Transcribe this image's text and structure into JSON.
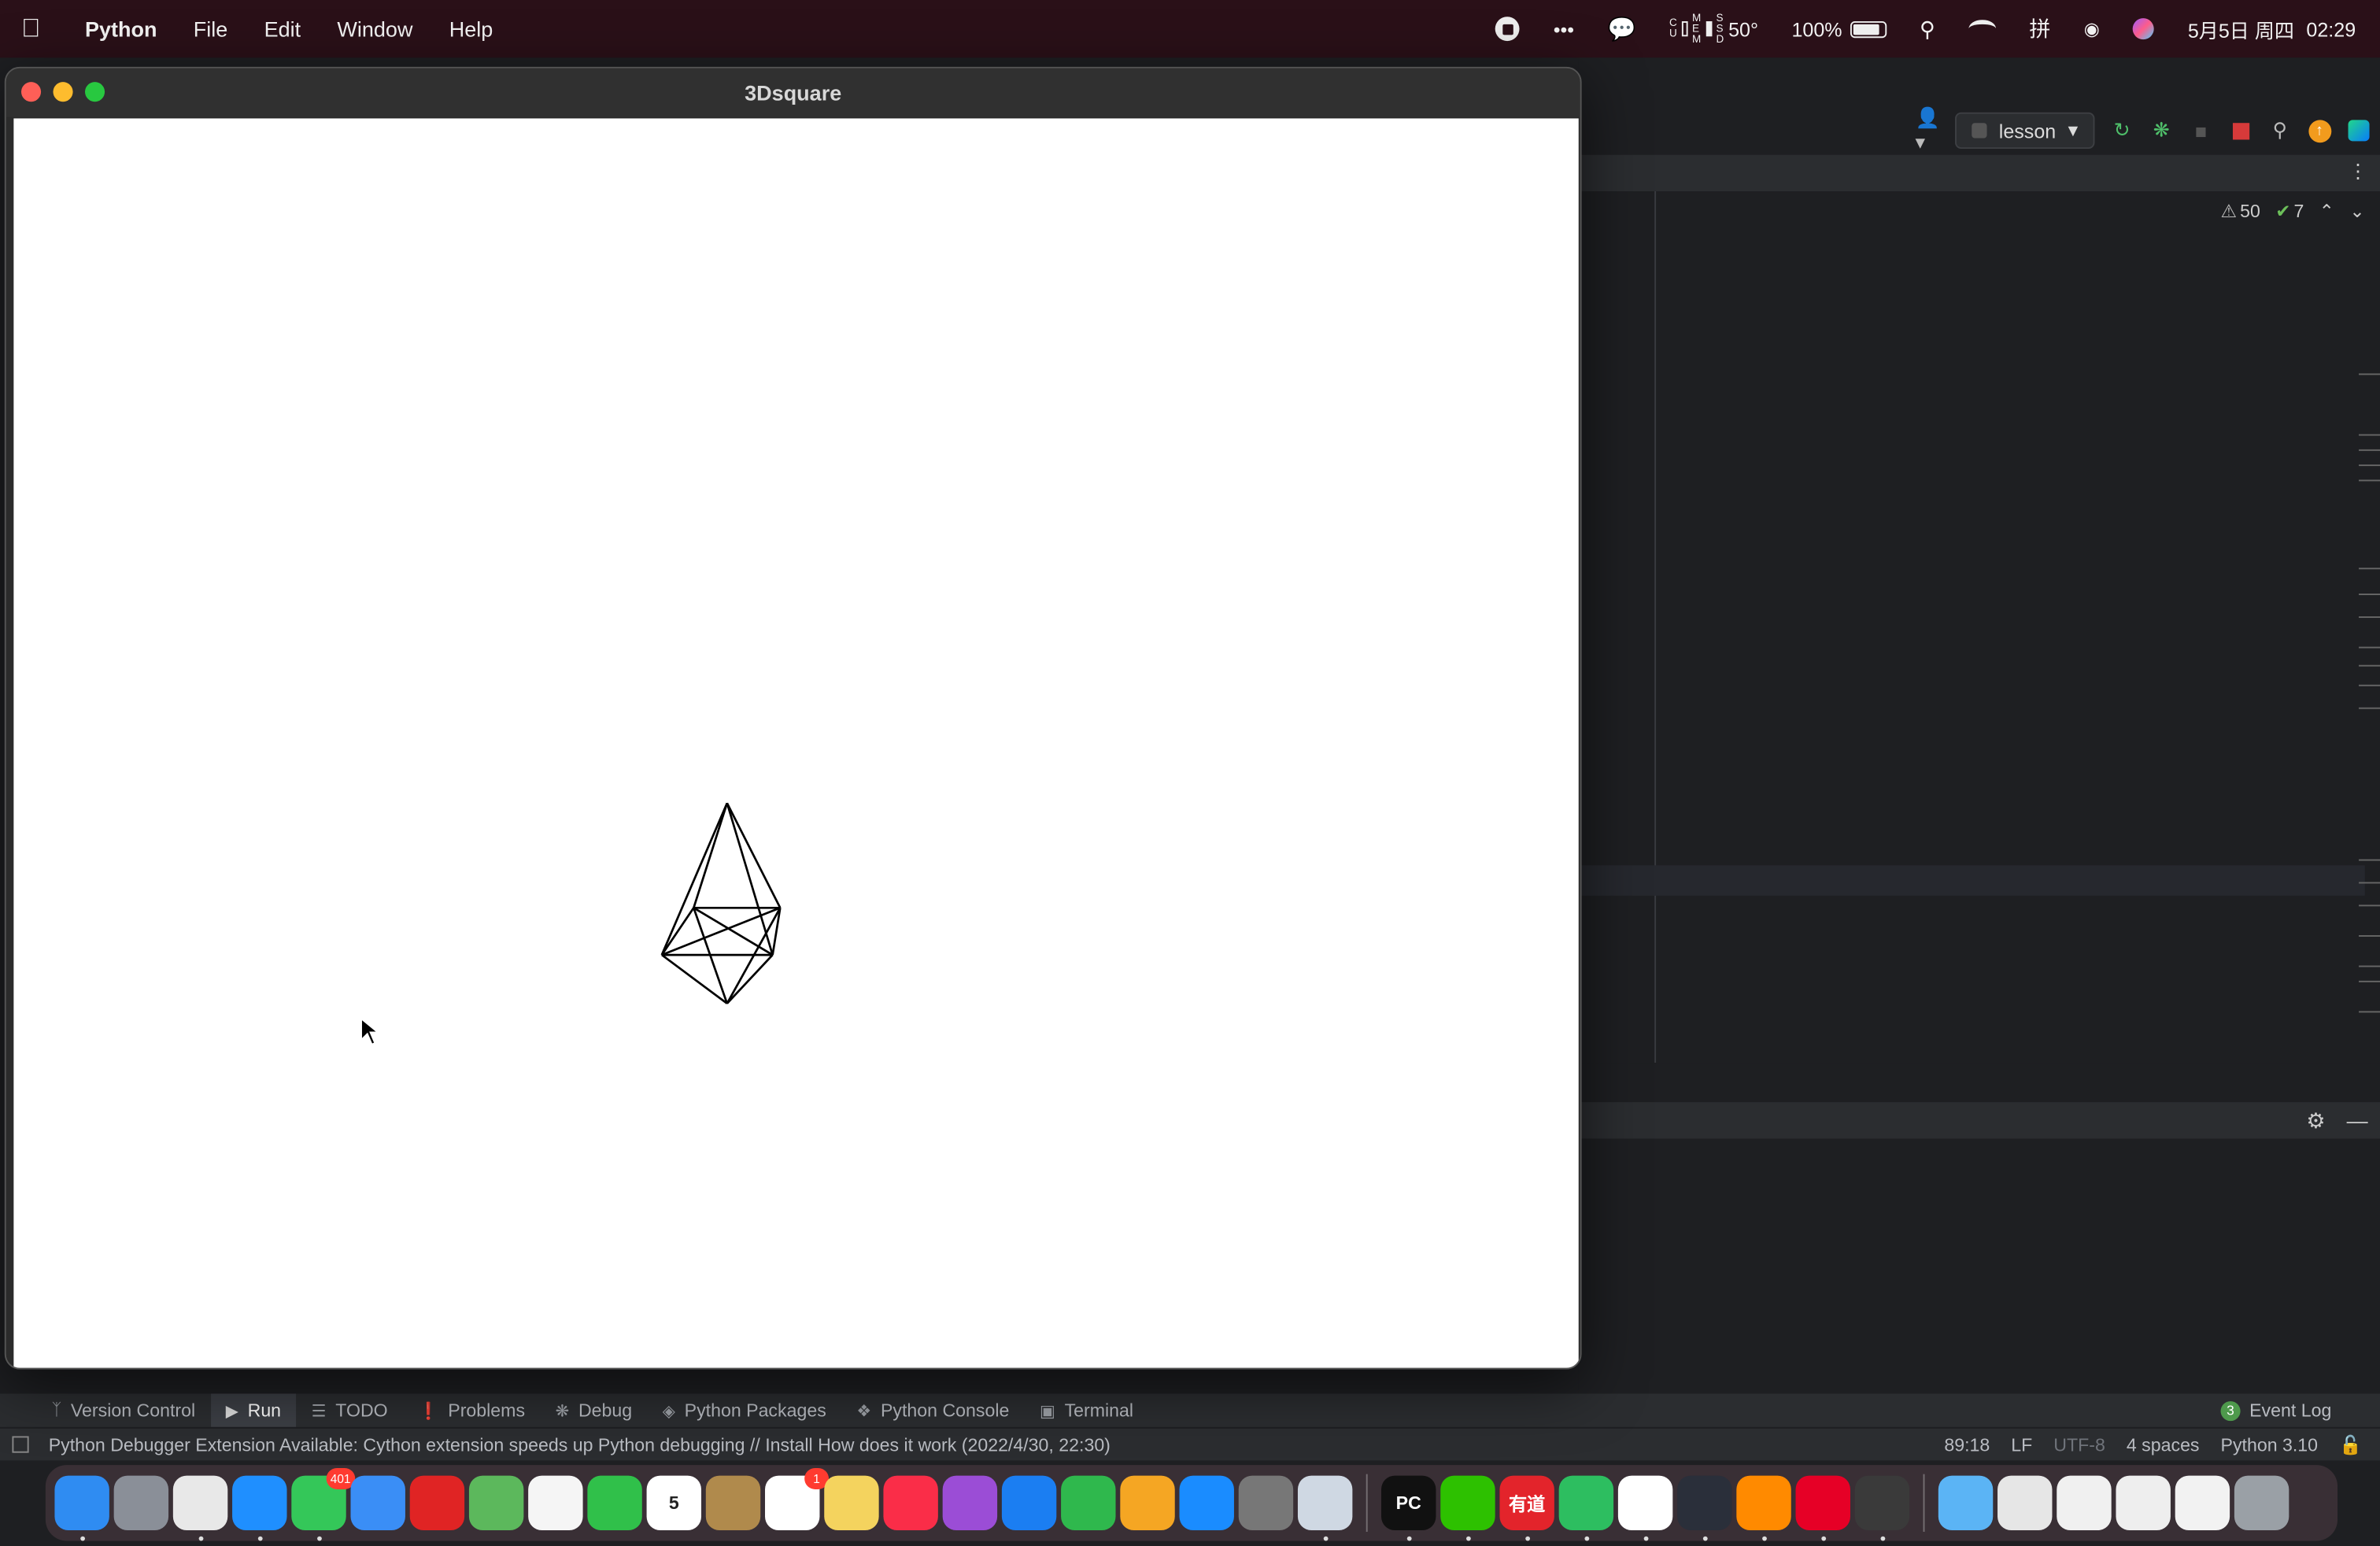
{
  "menubar": {
    "app_name": "Python",
    "items": [
      "File",
      "Edit",
      "Window",
      "Help"
    ],
    "status": {
      "weather": "50°",
      "battery_percent": "100%",
      "date": "5月5日 周四",
      "time": "02:29",
      "cpu_label": "C\nU",
      "mem_label": "M\nE\nM",
      "ssd_label": "S\nS\nD"
    }
  },
  "python_window": {
    "title": "3Dsquare",
    "canvas_background": "#ffffff",
    "stroke_color": "#000000"
  },
  "ide": {
    "run_config": "lesson",
    "inspections": {
      "warnings": "50",
      "weak_warnings": "7"
    },
    "toolbar_icons": [
      "profile-icon",
      "rerun-icon",
      "debug-icon",
      "stop-coverage-icon",
      "stop-icon",
      "search-icon",
      "update-icon",
      "jetbrains-icon"
    ]
  },
  "toolstrip": {
    "items": [
      {
        "label": "Version Control",
        "icon": "branch-icon"
      },
      {
        "label": "Run",
        "icon": "run-icon",
        "active": true
      },
      {
        "label": "TODO",
        "icon": "list-icon"
      },
      {
        "label": "Problems",
        "icon": "warning-icon"
      },
      {
        "label": "Debug",
        "icon": "bug-icon"
      },
      {
        "label": "Python Packages",
        "icon": "packages-icon"
      },
      {
        "label": "Python Console",
        "icon": "python-icon"
      },
      {
        "label": "Terminal",
        "icon": "terminal-icon"
      }
    ],
    "event_log_label": "Event Log",
    "event_log_count": "3"
  },
  "statusbar": {
    "message": "Python Debugger Extension Available: Cython extension speeds up Python debugging // Install   How does it work (2022/4/30, 22:30)",
    "position": "89:18",
    "line_sep": "LF",
    "encoding": "UTF-8",
    "indent": "4 spaces",
    "interpreter": "Python 3.10"
  },
  "dock": {
    "apps": [
      {
        "name": "Finder",
        "color": "#2f8cf2",
        "running": true
      },
      {
        "name": "Launchpad",
        "color": "#8a8f98"
      },
      {
        "name": "Chrome",
        "color": "#e8e8e8",
        "running": true
      },
      {
        "name": "Safari",
        "color": "#1f8fff",
        "running": true
      },
      {
        "name": "Messages",
        "color": "#34c759",
        "badge": "401",
        "running": true
      },
      {
        "name": "Mail",
        "color": "#3a8ef6"
      },
      {
        "name": "Stocks",
        "color": "#e02424"
      },
      {
        "name": "Maps",
        "color": "#5cb85c"
      },
      {
        "name": "Photos",
        "color": "#f5f5f5"
      },
      {
        "name": "FaceTime",
        "color": "#30c04a"
      },
      {
        "name": "Calendar",
        "color": "#ffffff",
        "label": "5"
      },
      {
        "name": "Notes Folder",
        "color": "#b08a4c"
      },
      {
        "name": "Reminders",
        "color": "#ffffff",
        "badge": "1"
      },
      {
        "name": "Notes",
        "color": "#f4d35e"
      },
      {
        "name": "Music",
        "color": "#fa2d48"
      },
      {
        "name": "Podcasts",
        "color": "#9b4dd6"
      },
      {
        "name": "Keynote",
        "color": "#1b7ef2"
      },
      {
        "name": "Numbers",
        "color": "#2fb84d"
      },
      {
        "name": "Pages",
        "color": "#f5a623"
      },
      {
        "name": "App Store",
        "color": "#1a8cff"
      },
      {
        "name": "System Preferences",
        "color": "#777777"
      },
      {
        "name": "Preview",
        "color": "#cfd8e3",
        "running": true
      },
      {
        "name": "PyCharm",
        "color": "#111111",
        "label": "PC",
        "running": true
      },
      {
        "name": "WeChat",
        "color": "#2dc100",
        "running": true
      },
      {
        "name": "Youdao",
        "color": "#e3242b",
        "label": "有道",
        "running": true
      },
      {
        "name": "Evernote",
        "color": "#2dbe60",
        "running": true
      },
      {
        "name": "WPS",
        "color": "#ffffff",
        "running": true
      },
      {
        "name": "QuickTime",
        "color": "#2a2f3a",
        "running": true
      },
      {
        "name": "Taobao",
        "color": "#ff8a00",
        "running": true
      },
      {
        "name": "NetEase Music",
        "color": "#e60026",
        "running": true
      },
      {
        "name": "Pen",
        "color": "#3a3a3a",
        "running": true
      },
      {
        "name": "Folder",
        "color": "#5bb4f5"
      },
      {
        "name": "Doc1",
        "color": "#e6e6e6"
      },
      {
        "name": "Doc2",
        "color": "#f0f0f0"
      },
      {
        "name": "Doc3",
        "color": "#eeeeee"
      },
      {
        "name": "Doc4",
        "color": "#f2f2f2"
      },
      {
        "name": "Trash",
        "color": "#9aa0a6"
      }
    ]
  }
}
